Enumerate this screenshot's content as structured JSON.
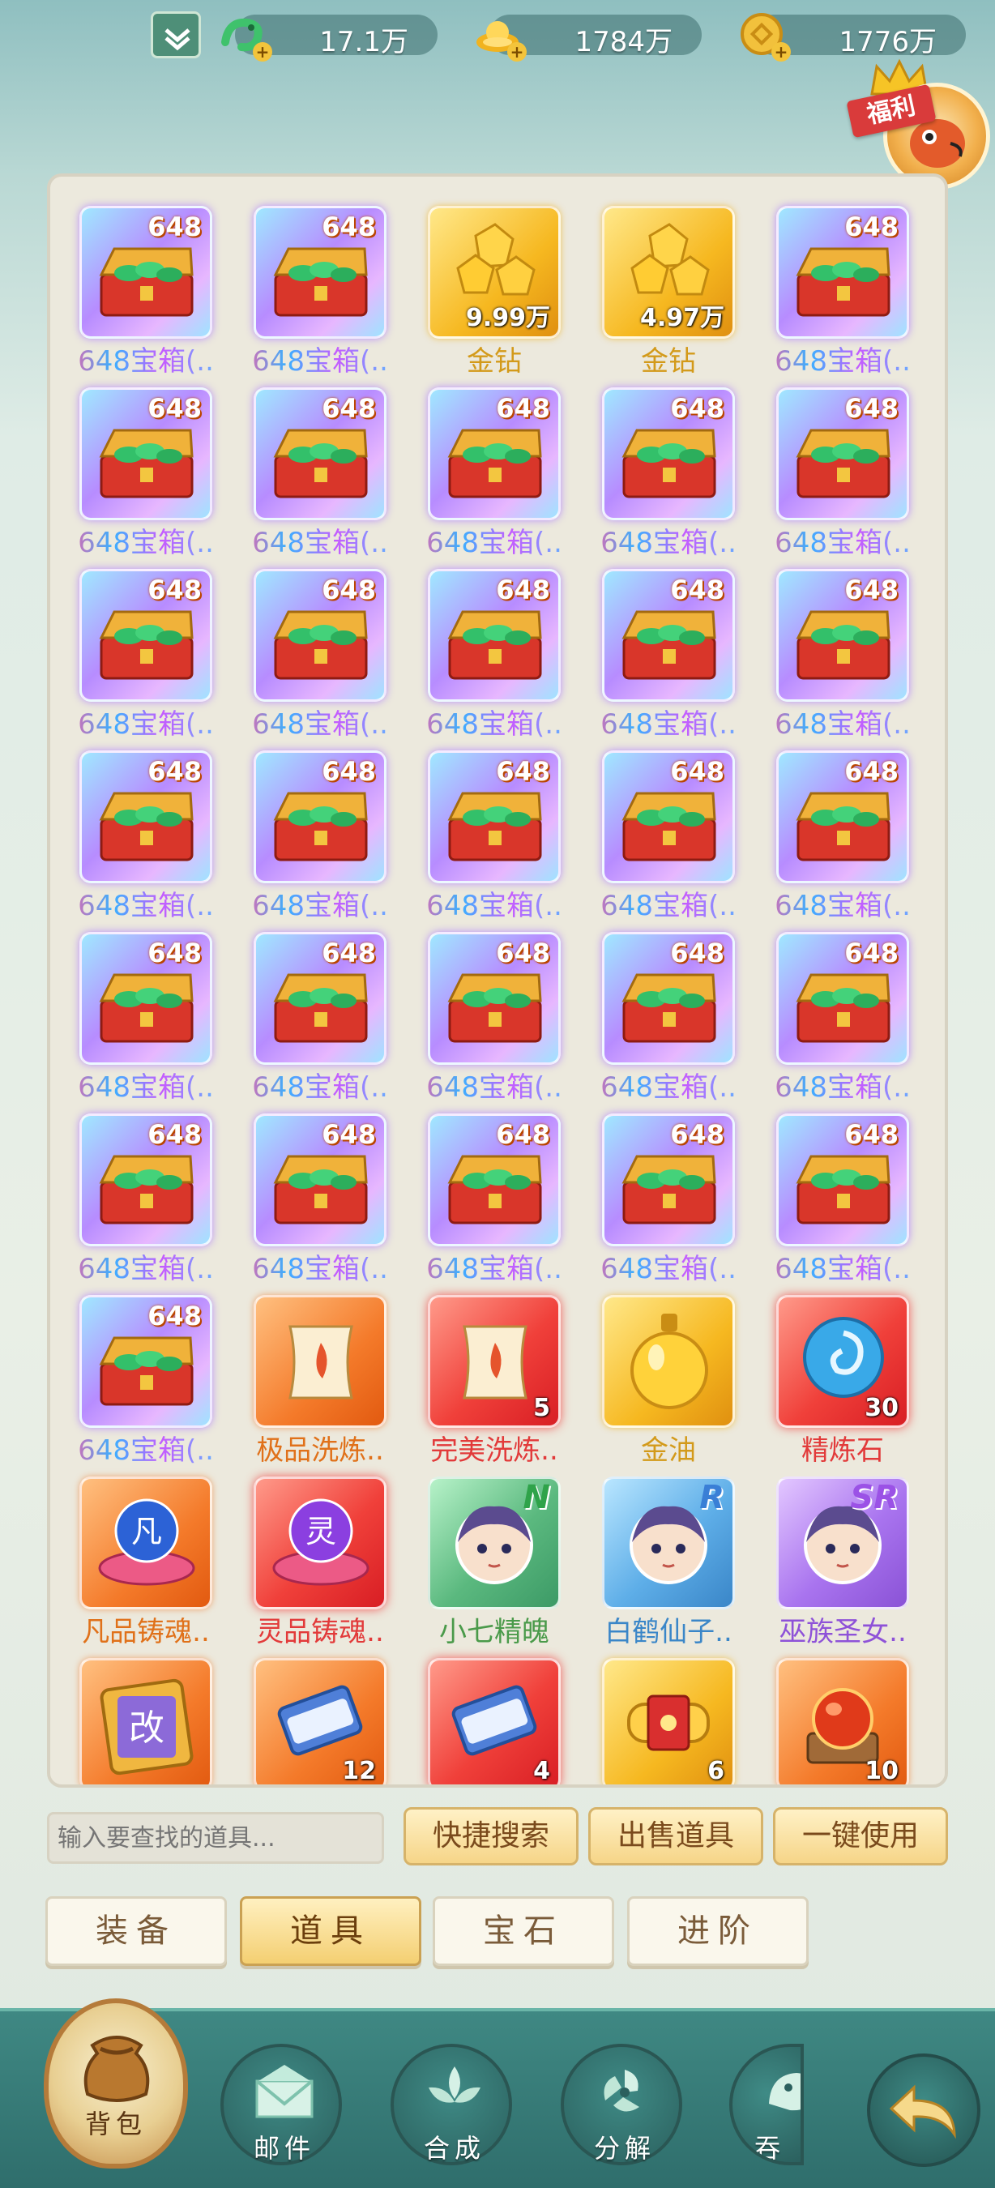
{
  "currency": [
    {
      "icon": "jade-dragon-icon",
      "value": "17.1万"
    },
    {
      "icon": "gold-ingot-icon",
      "value": "1784万"
    },
    {
      "icon": "copper-coin-icon",
      "value": "1776万"
    }
  ],
  "fuli_label": "福利",
  "items": [
    {
      "name": "648宝箱(..",
      "tag": "648",
      "count": "",
      "quality": "purple",
      "icon": "chest-icon",
      "label_style": "rainbow"
    },
    {
      "name": "648宝箱(..",
      "tag": "648",
      "count": "",
      "quality": "purple",
      "icon": "chest-icon",
      "label_style": "rainbow"
    },
    {
      "name": "金钻",
      "tag": "",
      "count": "9.99万",
      "quality": "gold",
      "icon": "gold-diamond-icon",
      "label_style": "gold"
    },
    {
      "name": "金钻",
      "tag": "",
      "count": "4.97万",
      "quality": "gold",
      "icon": "gold-diamond-icon",
      "label_style": "gold"
    },
    {
      "name": "648宝箱(..",
      "tag": "648",
      "count": "",
      "quality": "purple",
      "icon": "chest-icon",
      "label_style": "rainbow"
    },
    {
      "name": "648宝箱(..",
      "tag": "648",
      "count": "",
      "quality": "purple",
      "icon": "chest-icon",
      "label_style": "rainbow"
    },
    {
      "name": "648宝箱(..",
      "tag": "648",
      "count": "",
      "quality": "purple",
      "icon": "chest-icon",
      "label_style": "rainbow"
    },
    {
      "name": "648宝箱(..",
      "tag": "648",
      "count": "",
      "quality": "purple",
      "icon": "chest-icon",
      "label_style": "rainbow"
    },
    {
      "name": "648宝箱(..",
      "tag": "648",
      "count": "",
      "quality": "purple",
      "icon": "chest-icon",
      "label_style": "rainbow"
    },
    {
      "name": "648宝箱(..",
      "tag": "648",
      "count": "",
      "quality": "purple",
      "icon": "chest-icon",
      "label_style": "rainbow"
    },
    {
      "name": "648宝箱(..",
      "tag": "648",
      "count": "",
      "quality": "purple",
      "icon": "chest-icon",
      "label_style": "rainbow"
    },
    {
      "name": "648宝箱(..",
      "tag": "648",
      "count": "",
      "quality": "purple",
      "icon": "chest-icon",
      "label_style": "rainbow"
    },
    {
      "name": "648宝箱(..",
      "tag": "648",
      "count": "",
      "quality": "purple",
      "icon": "chest-icon",
      "label_style": "rainbow"
    },
    {
      "name": "648宝箱(..",
      "tag": "648",
      "count": "",
      "quality": "purple",
      "icon": "chest-icon",
      "label_style": "rainbow"
    },
    {
      "name": "648宝箱(..",
      "tag": "648",
      "count": "",
      "quality": "purple",
      "icon": "chest-icon",
      "label_style": "rainbow"
    },
    {
      "name": "648宝箱(..",
      "tag": "648",
      "count": "",
      "quality": "purple",
      "icon": "chest-icon",
      "label_style": "rainbow"
    },
    {
      "name": "648宝箱(..",
      "tag": "648",
      "count": "",
      "quality": "purple",
      "icon": "chest-icon",
      "label_style": "rainbow"
    },
    {
      "name": "648宝箱(..",
      "tag": "648",
      "count": "",
      "quality": "purple",
      "icon": "chest-icon",
      "label_style": "rainbow"
    },
    {
      "name": "648宝箱(..",
      "tag": "648",
      "count": "",
      "quality": "purple",
      "icon": "chest-icon",
      "label_style": "rainbow"
    },
    {
      "name": "648宝箱(..",
      "tag": "648",
      "count": "",
      "quality": "purple",
      "icon": "chest-icon",
      "label_style": "rainbow"
    },
    {
      "name": "648宝箱(..",
      "tag": "648",
      "count": "",
      "quality": "purple",
      "icon": "chest-icon",
      "label_style": "rainbow"
    },
    {
      "name": "648宝箱(..",
      "tag": "648",
      "count": "",
      "quality": "purple",
      "icon": "chest-icon",
      "label_style": "rainbow"
    },
    {
      "name": "648宝箱(..",
      "tag": "648",
      "count": "",
      "quality": "purple",
      "icon": "chest-icon",
      "label_style": "rainbow"
    },
    {
      "name": "648宝箱(..",
      "tag": "648",
      "count": "",
      "quality": "purple",
      "icon": "chest-icon",
      "label_style": "rainbow"
    },
    {
      "name": "648宝箱(..",
      "tag": "648",
      "count": "",
      "quality": "purple",
      "icon": "chest-icon",
      "label_style": "rainbow"
    },
    {
      "name": "648宝箱(..",
      "tag": "648",
      "count": "",
      "quality": "purple",
      "icon": "chest-icon",
      "label_style": "rainbow"
    },
    {
      "name": "648宝箱(..",
      "tag": "648",
      "count": "",
      "quality": "purple",
      "icon": "chest-icon",
      "label_style": "rainbow"
    },
    {
      "name": "648宝箱(..",
      "tag": "648",
      "count": "",
      "quality": "purple",
      "icon": "chest-icon",
      "label_style": "rainbow"
    },
    {
      "name": "648宝箱(..",
      "tag": "648",
      "count": "",
      "quality": "purple",
      "icon": "chest-icon",
      "label_style": "rainbow"
    },
    {
      "name": "648宝箱(..",
      "tag": "648",
      "count": "",
      "quality": "purple",
      "icon": "chest-icon",
      "label_style": "rainbow"
    },
    {
      "name": "648宝箱(..",
      "tag": "648",
      "count": "",
      "quality": "purple",
      "icon": "chest-icon",
      "label_style": "rainbow"
    },
    {
      "name": "极品洗炼..",
      "tag": "",
      "count": "",
      "quality": "orange",
      "icon": "refine-scroll-icon",
      "label_style": "orange"
    },
    {
      "name": "完美洗炼..",
      "tag": "",
      "count": "5",
      "quality": "red",
      "icon": "refine-scroll-icon",
      "label_style": "red"
    },
    {
      "name": "金油",
      "tag": "",
      "count": "",
      "quality": "gold",
      "icon": "oil-flask-icon",
      "label_style": "gold"
    },
    {
      "name": "精炼石",
      "tag": "",
      "count": "30",
      "quality": "red",
      "icon": "refine-stone-icon",
      "label_style": "red"
    },
    {
      "name": "凡品铸魂..",
      "tag": "",
      "count": "",
      "quality": "orange",
      "icon": "soul-orb-icon",
      "label_style": "orange",
      "glyph": "凡"
    },
    {
      "name": "灵品铸魂..",
      "tag": "",
      "count": "",
      "quality": "red",
      "icon": "soul-orb-icon",
      "label_style": "red",
      "glyph": "灵"
    },
    {
      "name": "小七精魄",
      "tag": "",
      "count": "",
      "quality": "green",
      "icon": "character-portrait-icon",
      "label_style": "green",
      "rarity": "N"
    },
    {
      "name": "白鹤仙子..",
      "tag": "",
      "count": "",
      "quality": "blue",
      "icon": "character-portrait-icon",
      "label_style": "blue",
      "rarity": "R"
    },
    {
      "name": "巫族圣女..",
      "tag": "",
      "count": "",
      "quality": "violet",
      "icon": "character-portrait-icon",
      "label_style": "violet",
      "rarity": "SR"
    },
    {
      "name": "",
      "tag": "",
      "count": "",
      "quality": "orange",
      "icon": "rename-card-icon",
      "label_style": "orange",
      "glyph": "改"
    },
    {
      "name": "",
      "tag": "",
      "count": "12",
      "quality": "orange",
      "icon": "scroll-bundle-icon",
      "label_style": "orange"
    },
    {
      "name": "",
      "tag": "",
      "count": "4",
      "quality": "red",
      "icon": "scroll-bundle-icon",
      "label_style": "red"
    },
    {
      "name": "",
      "tag": "",
      "count": "6",
      "quality": "gold",
      "icon": "gold-scroll-icon",
      "label_style": "gold"
    },
    {
      "name": "",
      "tag": "",
      "count": "10",
      "quality": "orange",
      "icon": "fire-orb-chest-icon",
      "label_style": "orange"
    }
  ],
  "search": {
    "placeholder": "输入要查找的道具..."
  },
  "actions": {
    "quick_search": "快捷搜索",
    "sell_items": "出售道具",
    "use_all": "一键使用"
  },
  "tabs": [
    {
      "label": "装备",
      "active": false
    },
    {
      "label": "道具",
      "active": true
    },
    {
      "label": "宝石",
      "active": false
    },
    {
      "label": "进阶",
      "active": false
    }
  ],
  "nav": [
    {
      "label": "背包",
      "icon": "bag-icon",
      "active": true
    },
    {
      "label": "邮件",
      "icon": "mail-icon",
      "active": false
    },
    {
      "label": "合成",
      "icon": "synthesis-icon",
      "active": false
    },
    {
      "label": "分解",
      "icon": "decompose-icon",
      "active": false
    },
    {
      "label": "吞",
      "icon": "devour-icon",
      "active": false
    }
  ],
  "back_icon": "back-arrow-icon",
  "colors": {
    "accent_gold": "#f6d588",
    "nav_bg": "#3f8883",
    "panel_bg": "#ece9dd"
  }
}
